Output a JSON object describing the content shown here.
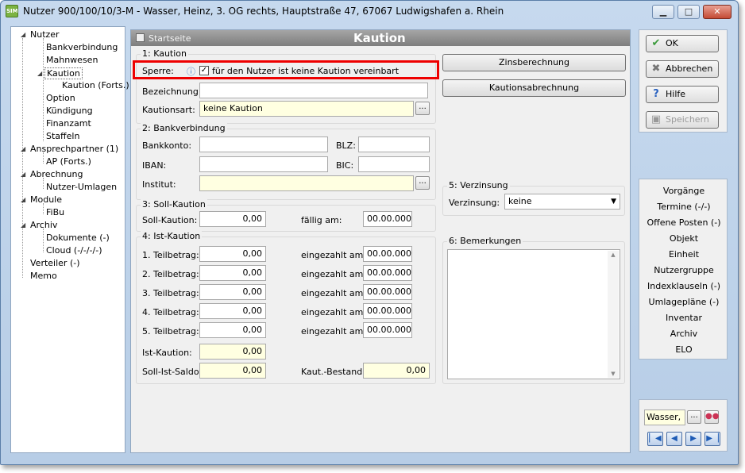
{
  "window": {
    "title": "Nutzer 900/100/10/3-M - Wasser, Heinz, 3. OG rechts, Hauptstraße 47, 67067 Ludwigshafen a. Rhein",
    "icon_text": "SIM"
  },
  "tree": {
    "nutzer": "Nutzer",
    "bankverbindung": "Bankverbindung",
    "mahnwesen": "Mahnwesen",
    "kaution": "Kaution",
    "kaution_forts": "Kaution (Forts.)",
    "option": "Option",
    "kuendigung": "Kündigung",
    "finanzamt": "Finanzamt",
    "staffeln": "Staffeln",
    "ansprechpartner": "Ansprechpartner (1)",
    "ap_forts": "AP (Forts.)",
    "abrechnung": "Abrechnung",
    "nutzer_umlagen": "Nutzer-Umlagen",
    "module": "Module",
    "fibu": "FiBu",
    "archiv": "Archiv",
    "dokumente": "Dokumente (-)",
    "cloud": "Cloud (-/-/-/-)",
    "verteiler": "Verteiler (-)",
    "memo": "Memo"
  },
  "header": {
    "startseite": "Startseite",
    "title": "Kaution"
  },
  "kaution": {
    "group": "1: Kaution",
    "sperre_label": "Sperre:",
    "sperre_text": "für den Nutzer ist keine Kaution vereinbart",
    "sperre_checked": "✓",
    "bezeichnung_label": "Bezeichnung:",
    "bezeichnung_value": "",
    "kautionsart_label": "Kautionsart:",
    "kautionsart_value": "keine Kaution",
    "dots": "..."
  },
  "bank": {
    "group": "2: Bankverbindung",
    "bankkonto_label": "Bankkonto:",
    "blz_label": "BLZ:",
    "iban_label": "IBAN:",
    "bic_label": "BIC:",
    "institut_label": "Institut:",
    "dots": "..."
  },
  "soll": {
    "group": "3: Soll-Kaution",
    "soll_label": "Soll-Kaution:",
    "soll_value": "0,00",
    "faellig_label": "fällig am:",
    "faellig_value": "00.00.0000"
  },
  "ist": {
    "group": "4: Ist-Kaution",
    "rows": [
      {
        "label": "1. Teilbetrag:",
        "value": "0,00",
        "date_label": "eingezahlt am:",
        "date": "00.00.0000"
      },
      {
        "label": "2. Teilbetrag:",
        "value": "0,00",
        "date_label": "eingezahlt am:",
        "date": "00.00.0000"
      },
      {
        "label": "3. Teilbetrag:",
        "value": "0,00",
        "date_label": "eingezahlt am:",
        "date": "00.00.0000"
      },
      {
        "label": "4. Teilbetrag:",
        "value": "0,00",
        "date_label": "eingezahlt am:",
        "date": "00.00.0000"
      },
      {
        "label": "5. Teilbetrag:",
        "value": "0,00",
        "date_label": "eingezahlt am:",
        "date": "00.00.0000"
      }
    ],
    "ist_label": "Ist-Kaution:",
    "ist_value": "0,00",
    "saldo_label": "Soll-Ist-Saldo:",
    "saldo_value": "0,00",
    "bestand_label": "Kaut.-Bestand:",
    "bestand_value": "0,00"
  },
  "buttons": {
    "zinsberechnung": "Zinsberechnung",
    "kautionsabrechnung": "Kautionsabrechnung"
  },
  "verzinsung": {
    "group": "5: Verzinsung",
    "label": "Verzinsung:",
    "value": "keine"
  },
  "bemerkungen": {
    "group": "6: Bemerkungen"
  },
  "actions": {
    "ok": "OK",
    "abbrechen": "Abbrechen",
    "hilfe": "Hilfe",
    "speichern": "Speichern"
  },
  "links": [
    "Vorgänge",
    "Termine (-/-)",
    "Offene Posten (-)",
    "Objekt",
    "Einheit",
    "Nutzergruppe",
    "Indexklauseln (-)",
    "Umlagepläne (-)",
    "Inventar",
    "Archiv",
    "ELO"
  ],
  "bottom": {
    "name_value": "Wasser,",
    "dots": "..."
  }
}
